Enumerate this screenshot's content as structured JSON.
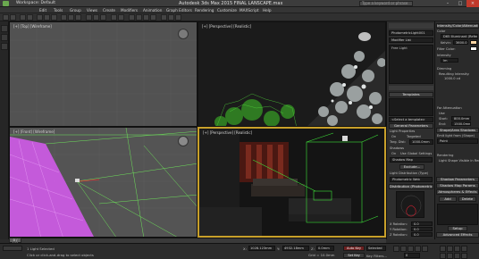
{
  "app": {
    "workspace": "Workspace: Default",
    "window_title": "Autodesk 3ds Max 2015    FINAL LANSCAPE.max",
    "search_placeholder": "Type a keyword or phrase"
  },
  "menu": [
    "Edit",
    "Tools",
    "Group",
    "Views",
    "Create",
    "Modifiers",
    "Animation",
    "Graph Editors",
    "Rendering",
    "Customize",
    "MAXScript",
    "Help"
  ],
  "viewports": {
    "top": "[+] [Top] [Wireframe]",
    "left": "[+] [Perspective] [Realistic]",
    "front": "[+] [Front] [Wireframe]",
    "persp": "[+] [Perspective] [Realistic]"
  },
  "command_panel": {
    "object_name": "PhotometricLight001",
    "modifier_list": "Modifier List",
    "stack_item": "Free Light",
    "templates_label": "Templates",
    "template_select": "<Select a template>",
    "general_params": "General Parameters",
    "light_props": "Light Properties",
    "on_label": "On",
    "targeted_label": "Targeted",
    "targ_dist_label": "Targ. Dist:",
    "targ_dist_value": "1000.0mm",
    "shadows_label": "Shadows",
    "shadows_on": "On",
    "use_global": "Use Global Settings",
    "shadow_type": "Shadow Map",
    "exclude_btn": "Exclude...",
    "light_dist_label": "Light Distribution (Type)",
    "light_dist_value": "Photometric Web",
    "dist_web_label": "Distribution (Photometric Web)",
    "x_rot": "X Rotation:",
    "x_rot_val": "0.0",
    "y_rot": "Y Rotation:",
    "y_rot_val": "0.0",
    "z_rot": "Z Rotation:",
    "z_rot_val": "0.0"
  },
  "material_panel": {
    "title": "Intensity/Color/Attenuation",
    "color_label": "Color",
    "color_select": "D65 Illuminant (Reference",
    "kelvin_label": "Kelvin:",
    "kelvin_value": "3600.0",
    "filter_label": "Filter Color:",
    "intensity_label": "Intensity",
    "lm_value": "lm",
    "dimming_label": "Dimming",
    "resulting_label": "Resulting Intensity:",
    "resulting_value": "1000.0 cd",
    "far_atten_label": "Far Attenuation",
    "use_label": "Use",
    "start_label": "Start:",
    "start_value": "800.0mm",
    "end_label": "End:",
    "end_value": "1500.0mm",
    "shape_label": "Shape/Area Shadows",
    "emit_label": "Emit light from (Shape)",
    "emit_value": "Point",
    "rendering_label": "Rendering",
    "light_shape": "Light Shape Visible in Rendering",
    "shadow_params": "Shadow Parameters",
    "shadow_map_params": "Shadow Map Params",
    "atmos_label": "Atmospheres & Effects",
    "add_btn": "Add",
    "delete_btn": "Delete",
    "setup_btn": "Setup",
    "adv_effects": "Advanced Effects",
    "mental_ray": "mental ray Indirect Illumination"
  },
  "timeline": {
    "slider": "0 / 100",
    "ticks": [
      "0",
      "5",
      "10",
      "15",
      "20",
      "25",
      "30",
      "35",
      "40",
      "45",
      "50",
      "55",
      "60",
      "65",
      "70",
      "75",
      "80",
      "85",
      "90",
      "95",
      "100"
    ]
  },
  "status": {
    "selection": "1 Light Selected",
    "prompt": "Click or click-and-drag to select objects",
    "x_label": "X:",
    "x_value": "1028.123mm",
    "y_label": "Y:",
    "y_value": "4932.18mm",
    "z_label": "Z:",
    "z_value": "0.0mm",
    "grid": "Grid = 10.0mm",
    "auto_key": "Auto Key",
    "selected": "Selected",
    "set_key": "Set Key",
    "key_filters": "Key Filters...",
    "frame": "0"
  },
  "colors": {
    "wire_pink": "#d85cf2",
    "wire_green": "#6ee35a",
    "viewport_gray": "#525252",
    "active_border": "#c8a02a"
  }
}
